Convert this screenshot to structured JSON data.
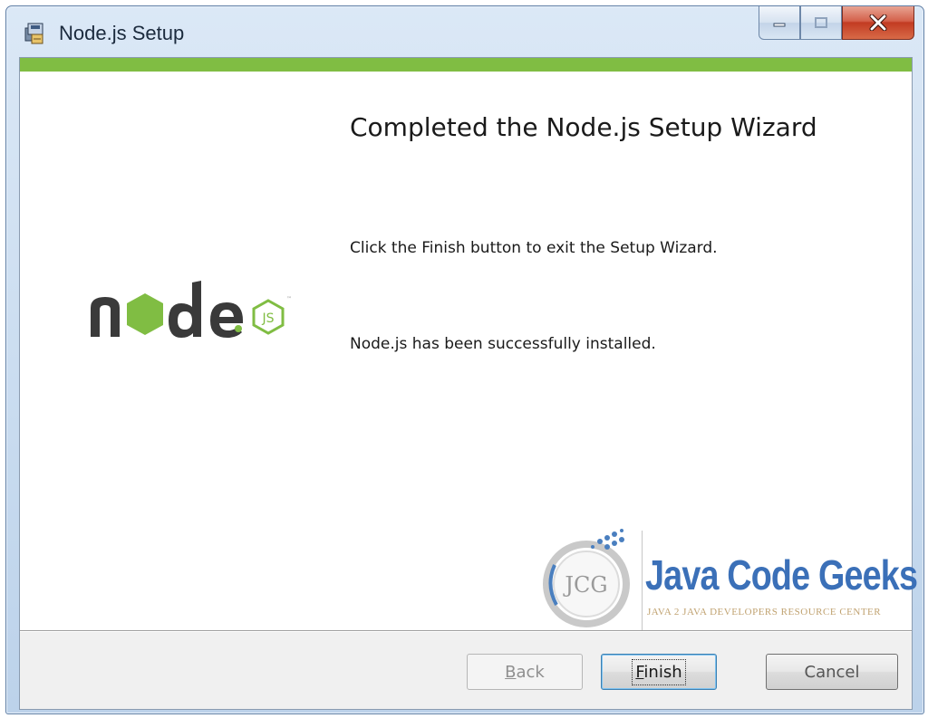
{
  "window": {
    "title": "Node.js Setup"
  },
  "title_buttons": {
    "minimize_icon": "minimize-icon",
    "maximize_icon": "maximize-icon",
    "close_icon": "close-icon"
  },
  "content": {
    "heading": "Completed the Node.js Setup Wizard",
    "line1": "Click the Finish button to exit the Setup Wizard.",
    "line2": "Node.js has been successfully installed.",
    "logo_text": "node",
    "accent_color": "#80bd43"
  },
  "watermark": {
    "brand": "Java Code Geeks",
    "badge": "JCG",
    "tagline": "JAVA 2 JAVA DEVELOPERS RESOURCE CENTER"
  },
  "buttons": {
    "back": {
      "label_rest": "ack",
      "label_mnemonic": "B"
    },
    "finish": {
      "label_rest": "inish",
      "label_mnemonic": "F"
    },
    "cancel": {
      "label": "Cancel"
    }
  }
}
